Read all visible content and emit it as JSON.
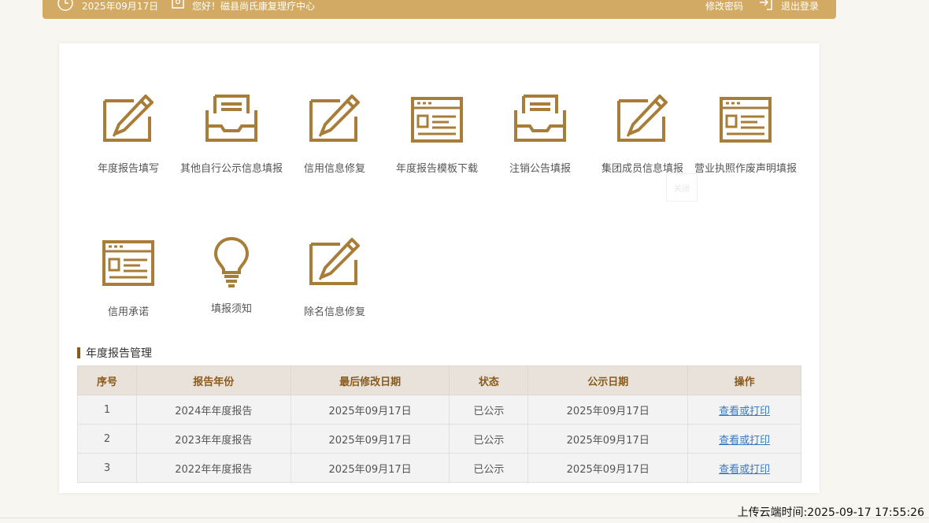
{
  "topbar": {
    "date": "2025年09月17日",
    "greeting": "您好！磁县尚氏康复理疗中心",
    "change_password": "修改密码",
    "logout": "退出登录"
  },
  "accent_color": "#a87d37",
  "menu": {
    "row1": [
      {
        "label": "年度报告填写",
        "icon": "edit-icon"
      },
      {
        "label": "其他自行公示信息填报",
        "icon": "inbox-document-icon"
      },
      {
        "label": "信用信息修复",
        "icon": "edit-icon"
      },
      {
        "label": "年度报告模板下载",
        "icon": "template-window-icon"
      },
      {
        "label": "注销公告填报",
        "icon": "inbox-document-icon"
      },
      {
        "label": "集团成员信息填报",
        "icon": "edit-icon"
      },
      {
        "label": "营业执照作废声明填报",
        "icon": "template-window-icon"
      }
    ],
    "row2": [
      {
        "label": "信用承诺",
        "icon": "template-window-icon"
      },
      {
        "label": "填报须知",
        "icon": "lightbulb-icon"
      },
      {
        "label": "除名信息修复",
        "icon": "edit-icon"
      }
    ],
    "close_hint": "关闭"
  },
  "reports_section": {
    "title": "年度报告管理",
    "columns": [
      "序号",
      "报告年份",
      "最后修改日期",
      "状态",
      "公示日期",
      "操作"
    ],
    "rows": [
      {
        "no": "1",
        "year": "2024年年度报告",
        "modified": "2025年09月17日",
        "status": "已公示",
        "public_date": "2025年09月17日",
        "action": "查看或打印"
      },
      {
        "no": "2",
        "year": "2023年年度报告",
        "modified": "2025年09月17日",
        "status": "已公示",
        "public_date": "2025年09月17日",
        "action": "查看或打印"
      },
      {
        "no": "3",
        "year": "2022年年度报告",
        "modified": "2025年09月17日",
        "status": "已公示",
        "public_date": "2025年09月17日",
        "action": "查看或打印"
      }
    ]
  },
  "upload_time": "上传云端时间:2025-09-17 17:55:26"
}
